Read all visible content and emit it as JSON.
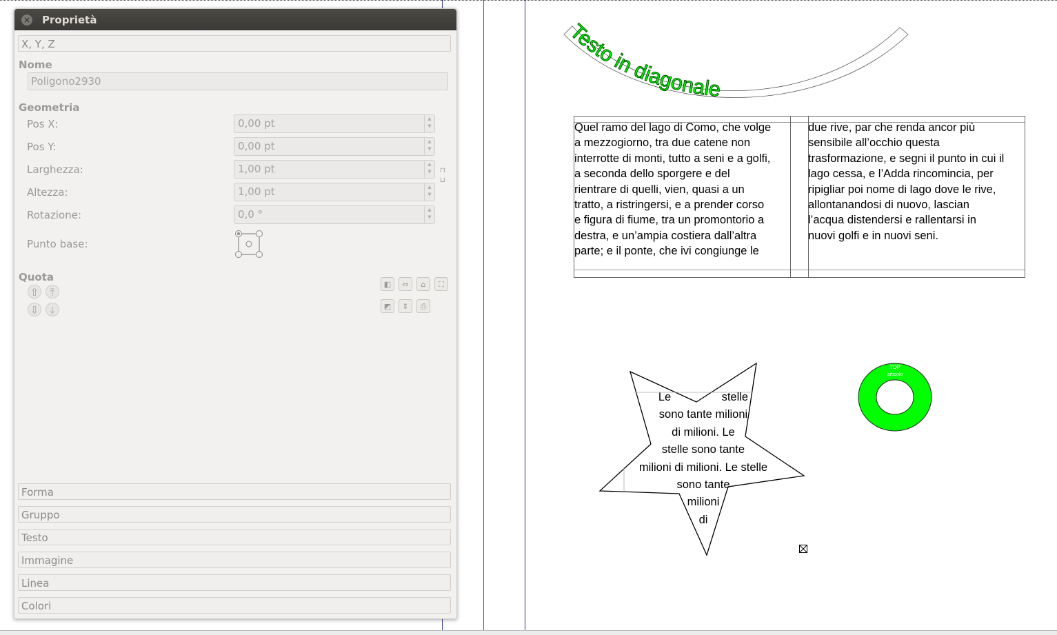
{
  "panel": {
    "title": "Proprietà",
    "sections_top": [
      "X, Y, Z"
    ],
    "name_header": "Nome",
    "name_value": "Poligono2930",
    "geometry_header": "Geometria",
    "fields": [
      {
        "label": "Pos X:",
        "value": "0,00 pt"
      },
      {
        "label": "Pos Y:",
        "value": "0,00 pt"
      },
      {
        "label": "Larghezza:",
        "value": "1,00 pt"
      },
      {
        "label": "Altezza:",
        "value": "1,00 pt"
      },
      {
        "label": "Rotazione:",
        "value": "0,0 °"
      }
    ],
    "basepoint_label": "Punto base:",
    "level_header": "Quota",
    "sections_bottom": [
      "Forma",
      "Gruppo",
      "Testo",
      "Immagine",
      "Linea",
      "Colori"
    ]
  },
  "document": {
    "path_text": "Testo in diagonale",
    "column1_lines": [
      "Quel ramo del lago di Como, che volge",
      "a mezzogiorno, tra due catene non",
      "interrotte di monti, tutto a seni e a golfi,",
      "a seconda dello sporgere e del",
      "rientrare di quelli, vien, quasi a un",
      "tratto, a ristringersi, e a prender corso",
      "e figura di fiume, tra un promontorio a",
      "destra, e un’ampia costiera dall’altra",
      "parte; e il ponte, che ivi congiunge le"
    ],
    "column2_lines": [
      "due rive, par che renda ancor più",
      "sensibile all’occhio questa",
      "trasformazione, e segni il punto in cui il",
      "lago cessa, e l’Adda rincomincia, per",
      "ripigliar poi nome di lago dove le rive,",
      "allontanandosi di nuovo, lascian",
      "l’acqua distendersi e rallentarsi in",
      "nuovi golfi e in nuovi seni."
    ],
    "star_lines": [
      "Le                stelle",
      "sono tante milioni",
      "di milioni. Le",
      "stelle sono tante",
      "milioni di milioni. Le stelle",
      "sono tante",
      "milioni",
      "di"
    ],
    "ring_text_1": "TOP",
    "ring_text_2": "articolo",
    "colors": {
      "green": "#00ff00",
      "dark_green": "#007700",
      "margin_red": "#c00000",
      "margin_blue": "#0000aa"
    }
  }
}
